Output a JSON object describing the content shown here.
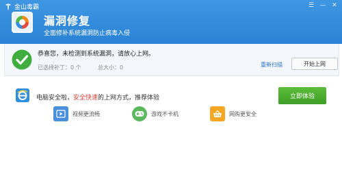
{
  "window": {
    "brand_name": "金山毒霸",
    "controls": [
      "☰",
      "—",
      "✕"
    ]
  },
  "header": {
    "title": "漏洞修复",
    "subtitle": "全面修补系统漏洞防止病毒入侵"
  },
  "status": {
    "message": "恭喜您，未检测到系统漏洞，请放心上网。",
    "selected_patches": "已选择补丁：0 个",
    "total_size": "总大小：0",
    "rescan_label": "重新扫描",
    "browse_label": "开始上网"
  },
  "promo": {
    "text_prefix": "电脑安全啦，",
    "text_highlight": "安全快速",
    "text_suffix": "的上网方式，推荐体验",
    "cta_label": "立即体验",
    "features": [
      {
        "label": "视频更流畅",
        "icon": "video-icon",
        "color": "#4a8fdc"
      },
      {
        "label": "游戏不卡机",
        "icon": "gamepad-icon",
        "color": "#5cb85c"
      },
      {
        "label": "网购更安全",
        "icon": "shopping-basket-icon",
        "color": "#f5a623"
      }
    ]
  },
  "colors": {
    "header_blue": "#2a82d6",
    "success_green": "#3fae3f",
    "cta_green": "#4aae2e",
    "highlight_red": "#e0403c",
    "link_blue": "#2a73cc"
  }
}
